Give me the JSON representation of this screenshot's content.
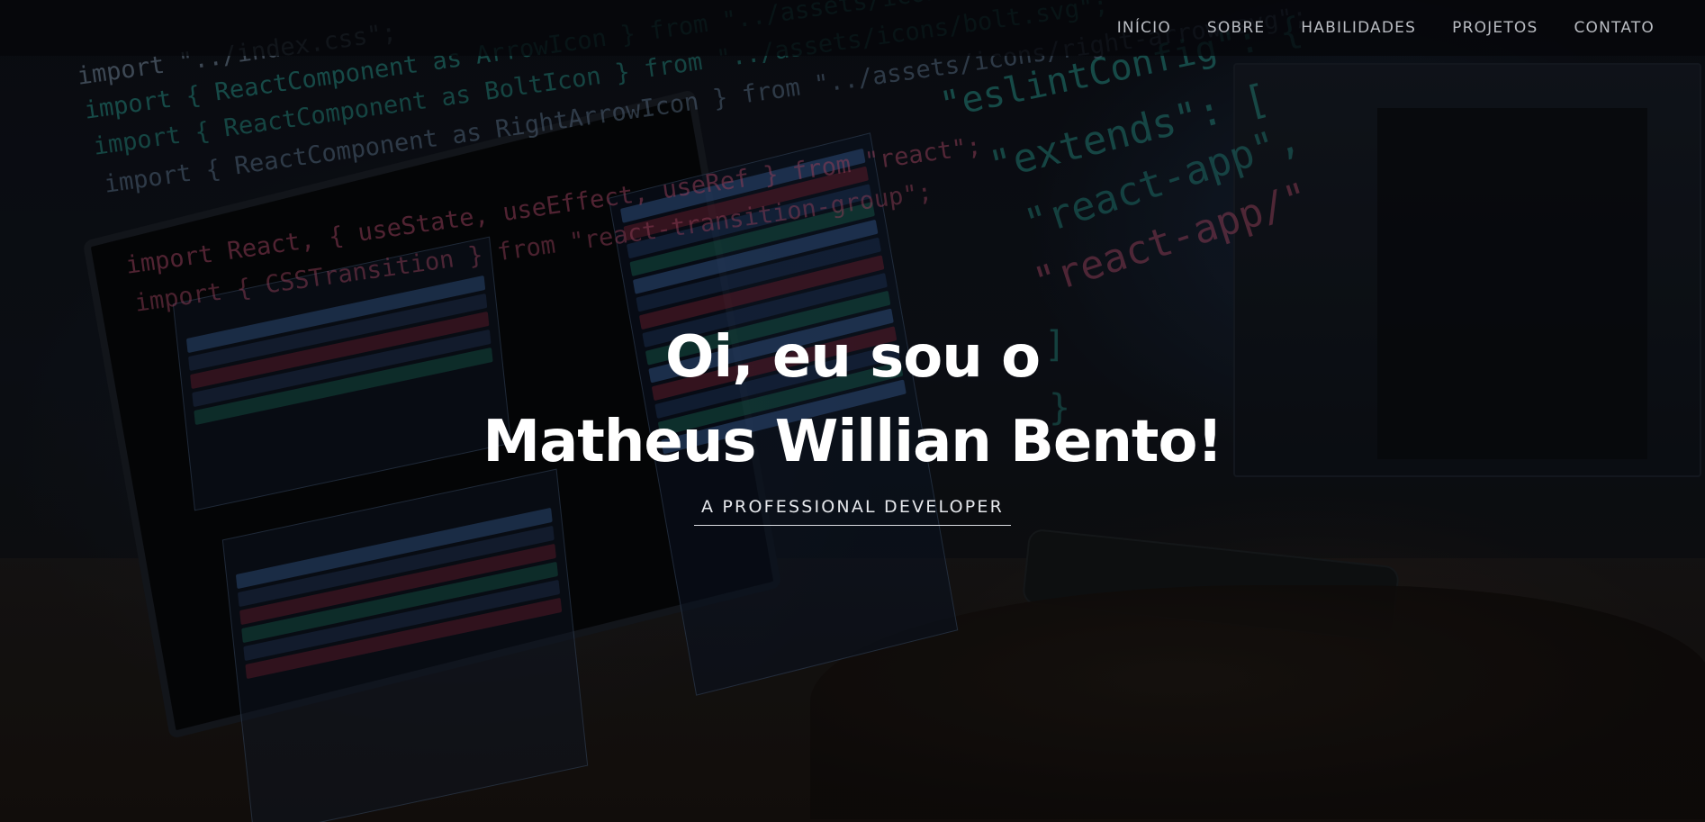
{
  "nav": {
    "items": [
      {
        "label": "INÍCIO"
      },
      {
        "label": "SOBRE"
      },
      {
        "label": "HABILIDADES"
      },
      {
        "label": "PROJETOS"
      },
      {
        "label": "CONTATO"
      }
    ]
  },
  "hero": {
    "greeting": "Oi, eu sou o",
    "name": "Matheus Willian Bento!",
    "tagline": "A PROFESSIONAL DEVELOPER"
  },
  "background_code": {
    "lines": [
      "import \"../index.css\";",
      "import { ReactComponent as ArrowIcon } from \"../assets/icons/arrow.svg\";",
      "import { ReactComponent as BoltIcon } from \"../assets/icons/bolt.svg\";",
      "import { ReactComponent as RightArrowIcon } from \"../assets/icons/right-arrow.svg\";",
      "import React, { useState, useEffect, useRef } from \"react\";",
      "import { CSSTransition } from \"react-transition-group\";"
    ],
    "config_lines": [
      "\"eslintConfig\": {",
      "\"extends\": [",
      "\"react-app\",",
      "\"react-app/\"",
      "]",
      "}"
    ]
  },
  "colors": {
    "accent_text": "#ffffff",
    "nav_text": "#b9bcc2",
    "code_teal": "#2fb3a6",
    "code_pink": "#d0577c",
    "code_blue": "#3f6ea8"
  }
}
